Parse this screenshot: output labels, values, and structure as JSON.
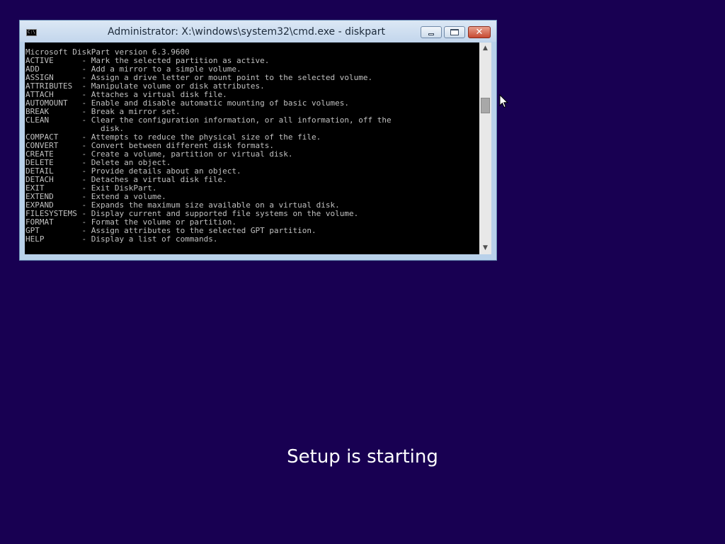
{
  "window": {
    "title": "Administrator: X:\\windows\\system32\\cmd.exe - diskpart",
    "icon": "cmd-icon",
    "icon_text": "C:\\",
    "close_glyph": "✕"
  },
  "console": {
    "version_line": "Microsoft DiskPart version 6.3.9600",
    "commands": [
      {
        "name": "ACTIVE",
        "desc": "Mark the selected partition as active."
      },
      {
        "name": "ADD",
        "desc": "Add a mirror to a simple volume."
      },
      {
        "name": "ASSIGN",
        "desc": "Assign a drive letter or mount point to the selected volume."
      },
      {
        "name": "ATTRIBUTES",
        "desc": "Manipulate volume or disk attributes."
      },
      {
        "name": "ATTACH",
        "desc": "Attaches a virtual disk file."
      },
      {
        "name": "AUTOMOUNT",
        "desc": "Enable and disable automatic mounting of basic volumes."
      },
      {
        "name": "BREAK",
        "desc": "Break a mirror set."
      },
      {
        "name": "CLEAN",
        "desc": "Clear the configuration information, or all information, off the\n                disk."
      },
      {
        "name": "COMPACT",
        "desc": "Attempts to reduce the physical size of the file."
      },
      {
        "name": "CONVERT",
        "desc": "Convert between different disk formats."
      },
      {
        "name": "CREATE",
        "desc": "Create a volume, partition or virtual disk."
      },
      {
        "name": "DELETE",
        "desc": "Delete an object."
      },
      {
        "name": "DETAIL",
        "desc": "Provide details about an object."
      },
      {
        "name": "DETACH",
        "desc": "Detaches a virtual disk file."
      },
      {
        "name": "EXIT",
        "desc": "Exit DiskPart."
      },
      {
        "name": "EXTEND",
        "desc": "Extend a volume."
      },
      {
        "name": "EXPAND",
        "desc": "Expands the maximum size available on a virtual disk."
      },
      {
        "name": "FILESYSTEMS",
        "desc": "Display current and supported file systems on the volume."
      },
      {
        "name": "FORMAT",
        "desc": "Format the volume or partition."
      },
      {
        "name": "GPT",
        "desc": "Assign attributes to the selected GPT partition."
      },
      {
        "name": "HELP",
        "desc": "Display a list of commands."
      }
    ]
  },
  "scrollbar": {
    "up_glyph": "▲",
    "down_glyph": "▼",
    "scroll_position": 0.25
  },
  "setup": {
    "status_text": "Setup is starting"
  },
  "colors": {
    "desktop_background": "#180052",
    "console_background": "#000000",
    "console_text": "#c0c0c0"
  }
}
